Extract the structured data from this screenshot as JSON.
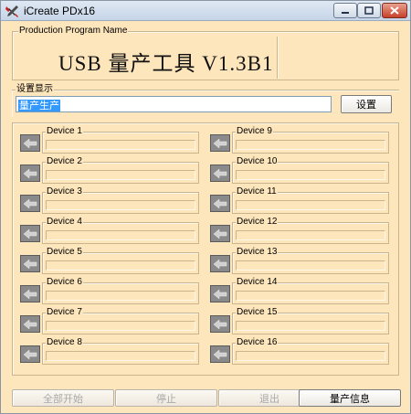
{
  "window": {
    "title": "iCreate PDx16",
    "icon": "tools-icon",
    "controls": {
      "minimize": "minimize-icon",
      "maximize": "maximize-icon",
      "close": "close-icon"
    }
  },
  "banner": {
    "group_label": "Production Program Name",
    "title": "USB 量产工具 V1.3B1"
  },
  "settings": {
    "group_label": "设置显示",
    "input_value": "量产生产",
    "button_label": "设置"
  },
  "devices": [
    {
      "label": "Device 1"
    },
    {
      "label": "Device 2"
    },
    {
      "label": "Device 3"
    },
    {
      "label": "Device 4"
    },
    {
      "label": "Device 5"
    },
    {
      "label": "Device 6"
    },
    {
      "label": "Device 7"
    },
    {
      "label": "Device 8"
    },
    {
      "label": "Device 9"
    },
    {
      "label": "Device 10"
    },
    {
      "label": "Device 11"
    },
    {
      "label": "Device 12"
    },
    {
      "label": "Device 13"
    },
    {
      "label": "Device 14"
    },
    {
      "label": "Device 15"
    },
    {
      "label": "Device 16"
    }
  ],
  "actions": {
    "start_all": "全部开始",
    "stop": "停止",
    "exit": "退出",
    "info": "量产信息"
  },
  "colors": {
    "window_bg": "#fde5bc",
    "selection": "#3399ff",
    "device_icon": "#8a8a8a"
  }
}
